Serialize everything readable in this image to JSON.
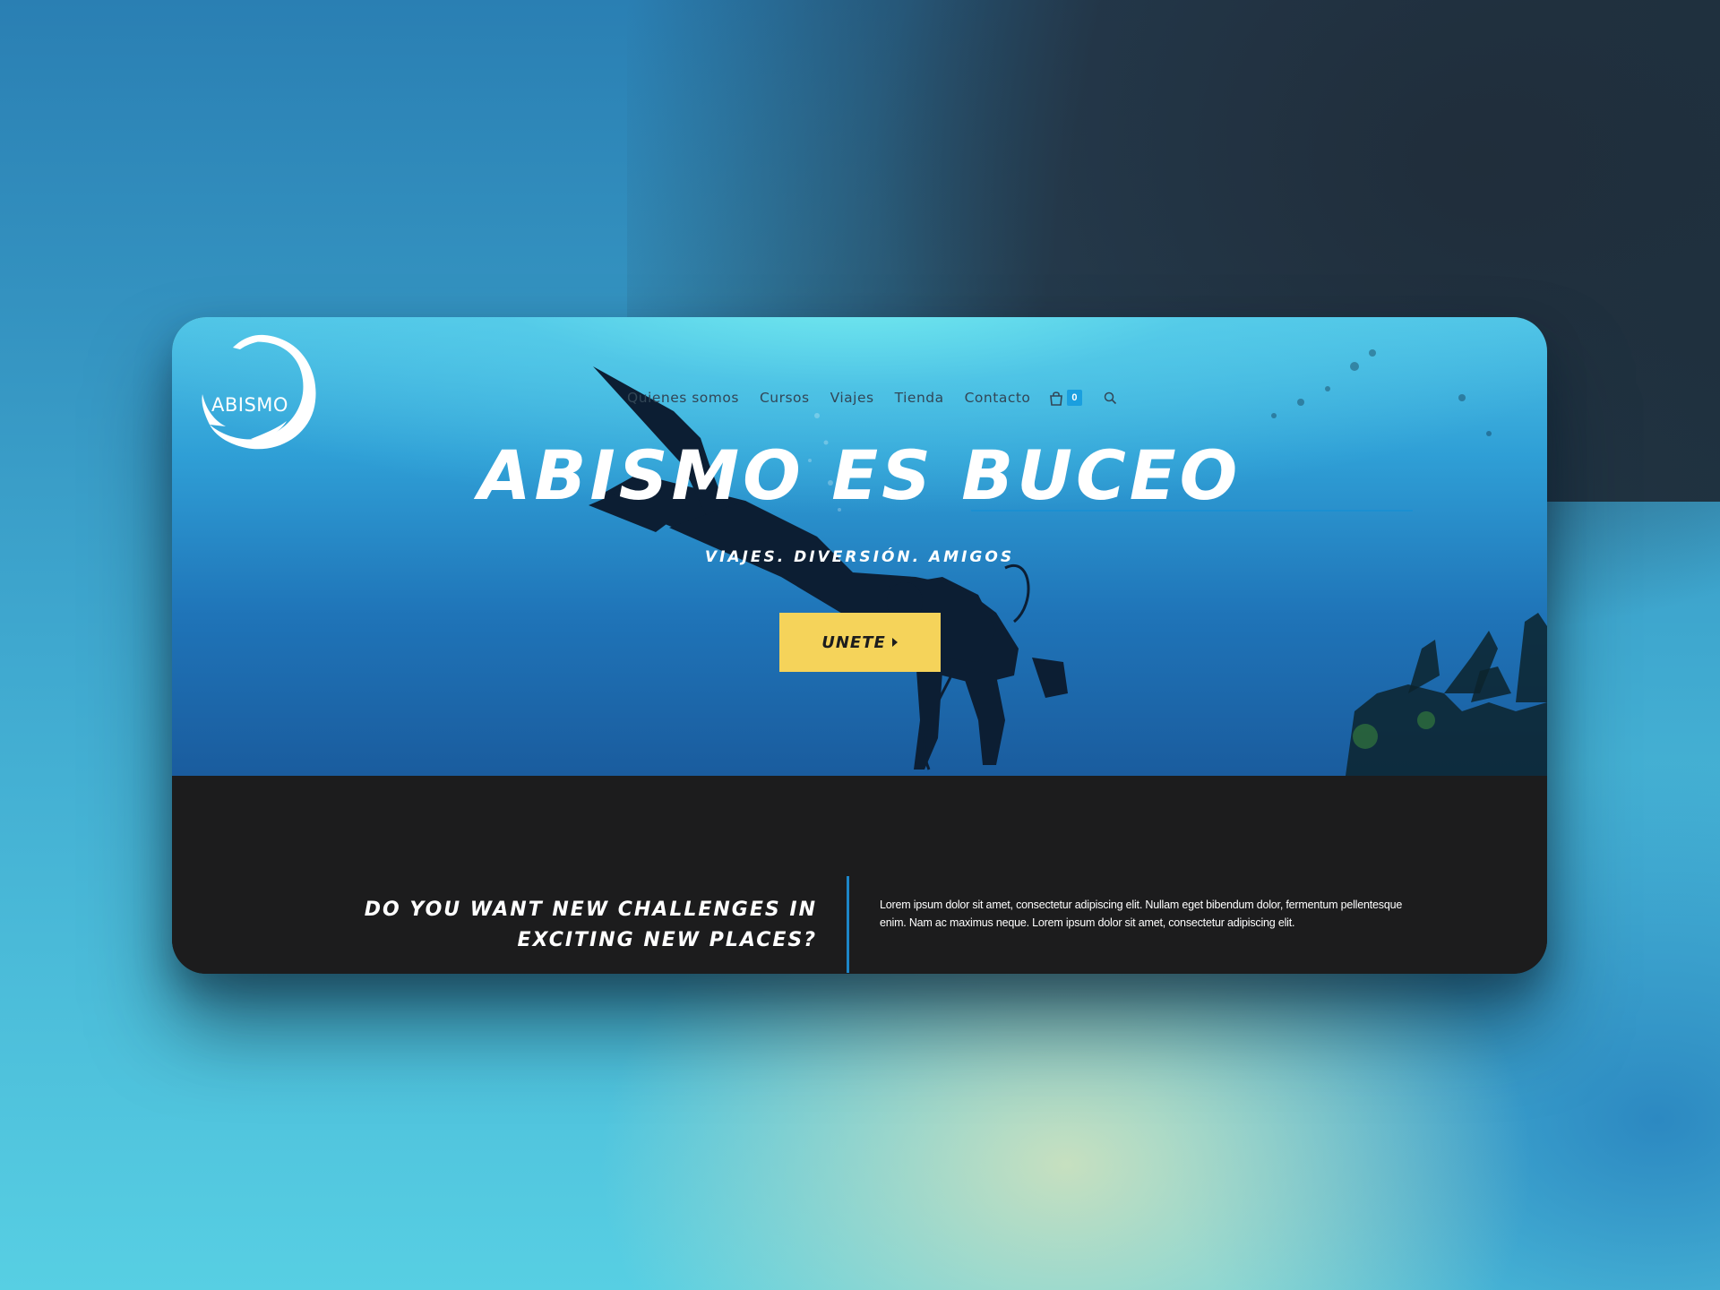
{
  "site": {
    "logo_text": "ABISMO"
  },
  "nav": {
    "items": [
      {
        "label": "Quienes somos"
      },
      {
        "label": "Cursos"
      },
      {
        "label": "Viajes"
      },
      {
        "label": "Tienda"
      },
      {
        "label": "Contacto"
      }
    ],
    "cart_count": "0",
    "cart_icon": "shopping-bag-icon",
    "search_icon": "search-icon"
  },
  "hero": {
    "title": "ABISMO ES BUCEO",
    "subtitle": "VIAJES. DIVERSIÓN. AMIGOS",
    "cta_label": "UNETE"
  },
  "section": {
    "heading": "DO YOU WANT NEW CHALLENGES IN EXCITING NEW PLACES?",
    "body": "Lorem ipsum dolor sit amet, consectetur adipiscing elit. Nullam eget bibendum dolor, fermentum pellentesque enim. Nam ac maximus neque. Lorem ipsum dolor sit amet, consectetur adipiscing elit."
  },
  "colors": {
    "accent_blue": "#1a9fdf",
    "cta_yellow": "#f5d35a",
    "dark_bg": "#1c1c1d"
  }
}
